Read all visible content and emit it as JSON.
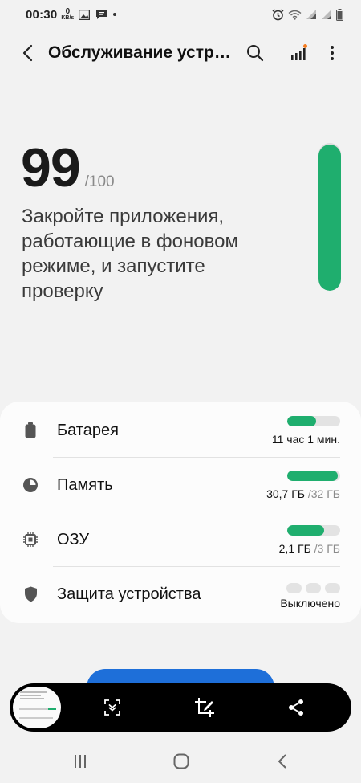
{
  "status_bar": {
    "time": "00:30",
    "speed_value": "0",
    "speed_unit": "KB/s",
    "icons_left": [
      "image-icon",
      "message-icon",
      "notification-dot"
    ],
    "icons_right": [
      "alarm-icon",
      "wifi-icon",
      "signal-icon",
      "signal-icon-2",
      "battery-icon"
    ]
  },
  "header": {
    "title": "Обслуживание устр…",
    "actions": [
      "search-icon",
      "diagnostics-icon",
      "more-options-icon"
    ],
    "notification_dot_color": "#f47c20"
  },
  "score": {
    "value": "99",
    "max": "/100",
    "message": "Закройте приложения, работающие в фоновом режиме, и запустите проверку",
    "level": 0.99
  },
  "items": [
    {
      "name": "battery",
      "label": "Батарея",
      "value": "11 час 1 мин.",
      "fill": 0.55
    },
    {
      "name": "storage",
      "label": "Память",
      "value": "30,7 ГБ",
      "total": "/32 ГБ",
      "fill": 0.96
    },
    {
      "name": "ram",
      "label": "ОЗУ",
      "value": "2,1 ГБ",
      "total": "/3 ГБ",
      "fill": 0.7
    },
    {
      "name": "security",
      "label": "Защита устройства",
      "value": "Выключено"
    }
  ],
  "colors": {
    "accent_green": "#1fae6e",
    "action_blue": "#1e6fd9",
    "background": "#f2f2f2"
  },
  "screenshot_toolbar": {
    "buttons": [
      "scroll-capture-icon",
      "crop-edit-icon",
      "share-icon"
    ]
  },
  "nav_bar": {
    "buttons": [
      "recent-apps-icon",
      "home-icon",
      "back-icon"
    ]
  }
}
